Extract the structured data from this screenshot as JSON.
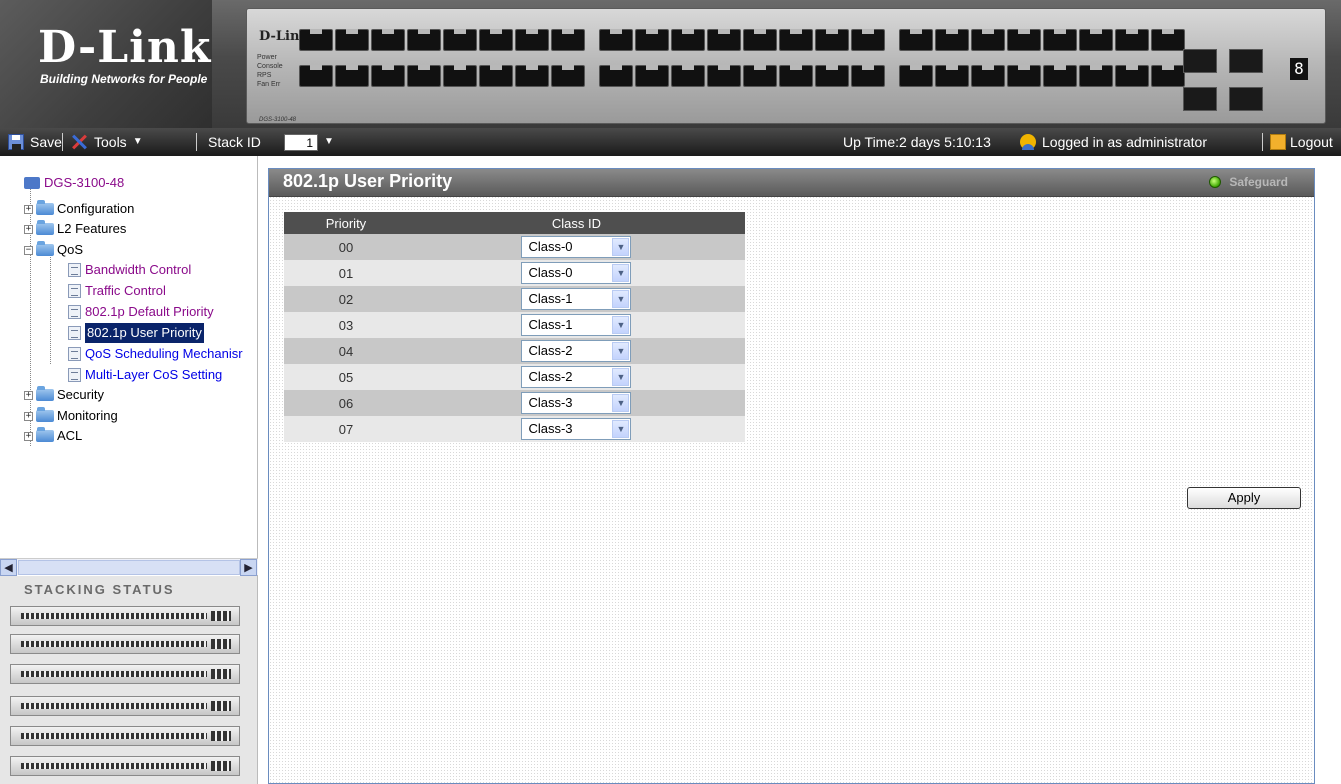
{
  "brand": {
    "logo": "D-Link",
    "tagline": "Building Networks for People"
  },
  "device": {
    "brand": "D-Link",
    "leds": [
      "Power",
      "Console",
      "RPS",
      "Fan Err"
    ],
    "model": "DGS-3100-48",
    "segment_display": "8"
  },
  "toolbar": {
    "save_label": "Save",
    "tools_label": "Tools",
    "stack_id_label": "Stack ID",
    "stack_id_value": "1",
    "uptime": "Up Time:2 days 5:10:13",
    "logged_in": "Logged in as administrator",
    "logout_label": "Logout"
  },
  "tree": {
    "root": "DGS-3100-48",
    "configuration": "Configuration",
    "l2": "L2 Features",
    "qos": "QoS",
    "qos_items": [
      "Bandwidth Control",
      "Traffic Control",
      "802.1p Default Priority",
      "802.1p User Priority",
      "QoS Scheduling Mechanisr",
      "Multi-Layer CoS Setting"
    ],
    "security": "Security",
    "monitoring": "Monitoring",
    "acl": "ACL"
  },
  "stacking": {
    "title": "STACKING STATUS",
    "unit_count": 6
  },
  "main": {
    "title": "802.1p User Priority",
    "safeguard": "Safeguard",
    "table": {
      "headers": [
        "Priority",
        "Class ID"
      ],
      "rows": [
        {
          "priority": "00",
          "class": "Class-0"
        },
        {
          "priority": "01",
          "class": "Class-0"
        },
        {
          "priority": "02",
          "class": "Class-1"
        },
        {
          "priority": "03",
          "class": "Class-1"
        },
        {
          "priority": "04",
          "class": "Class-2"
        },
        {
          "priority": "05",
          "class": "Class-2"
        },
        {
          "priority": "06",
          "class": "Class-3"
        },
        {
          "priority": "07",
          "class": "Class-3"
        }
      ]
    },
    "apply_label": "Apply"
  },
  "colors": {
    "header_dark": "#3a3a3a",
    "table_header": "#4f4f4f",
    "row_odd": "#c8c8c8",
    "row_even": "#e8e8e8",
    "tree_link": "#8a0a8a",
    "tree_link_alt": "#0000e6",
    "selection": "#0a246a"
  },
  "icons": {
    "save": "floppy-disk-icon",
    "tools": "tools-icon",
    "user": "user-icon",
    "logout": "logout-icon",
    "safeguard": "green-status-dot-icon"
  }
}
